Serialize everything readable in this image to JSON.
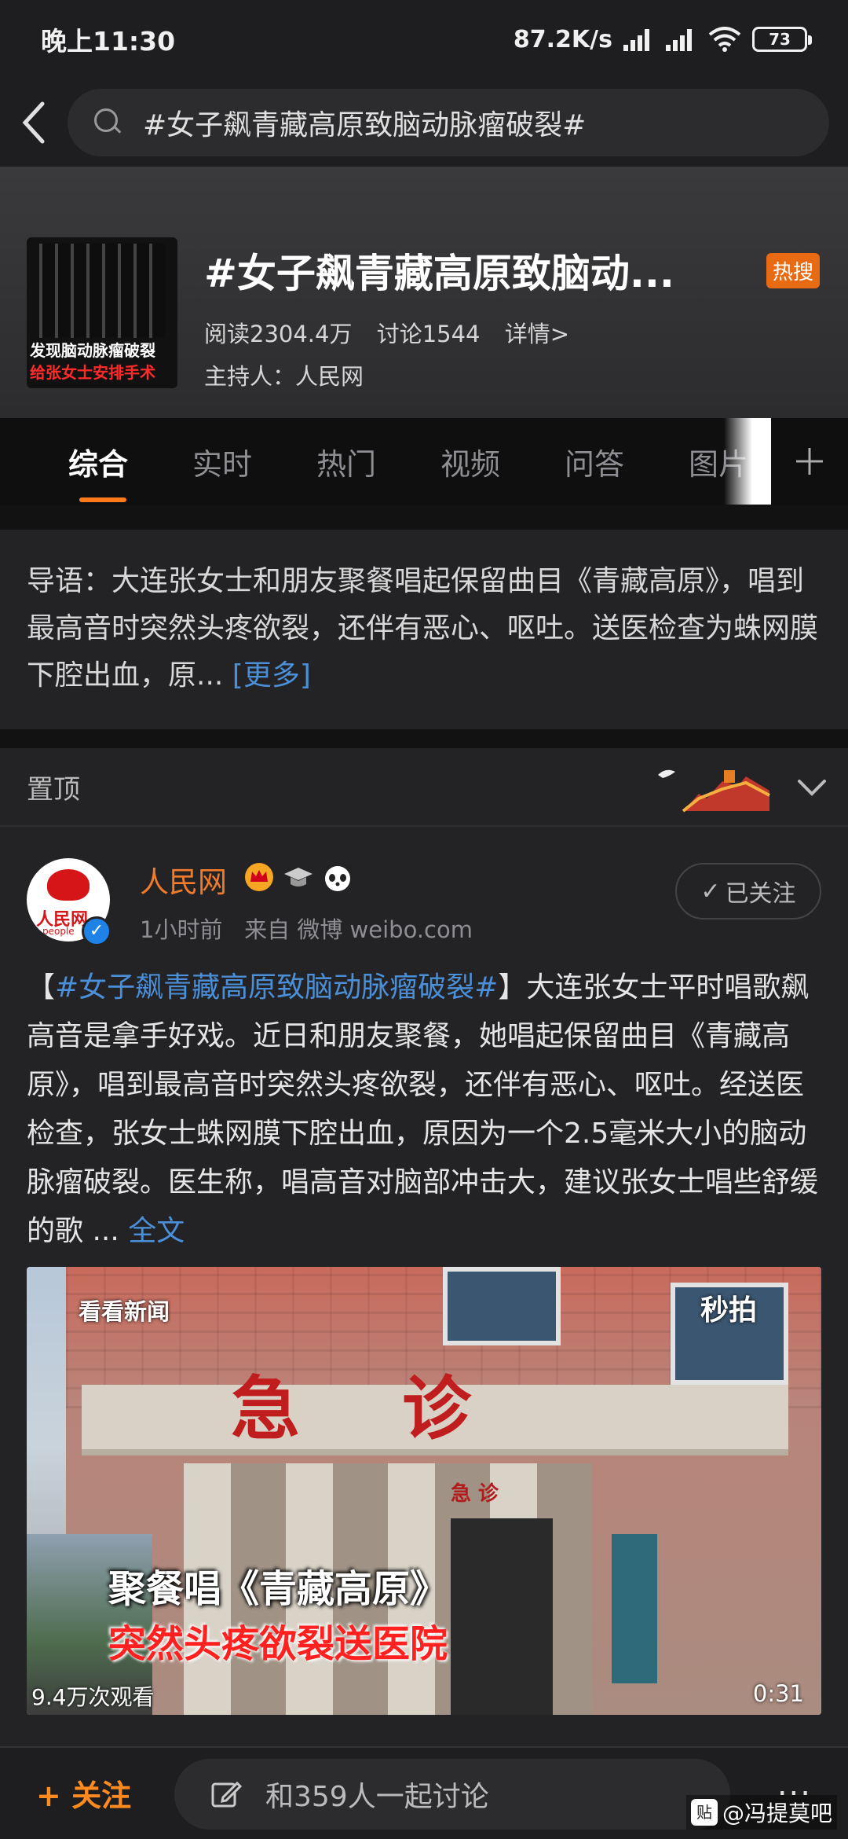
{
  "status_bar": {
    "time": "晚上11:30",
    "speed": "87.2K/s",
    "battery": "73"
  },
  "search": {
    "query": "#女子飙青藏高原致脑动脉瘤破裂#"
  },
  "topic": {
    "title": "#女子飙青藏高原致脑动...",
    "hot_badge": "热搜",
    "reads": "阅读2304.4万",
    "discussions": "讨论1544",
    "details_link": "详情>",
    "host": "主持人：人民网",
    "thumb_line1": "发现脑动脉瘤破裂",
    "thumb_line2": "给张女士安排手术"
  },
  "tabs": [
    "综合",
    "实时",
    "热门",
    "视频",
    "问答",
    "图片"
  ],
  "intro": {
    "text": "导语：大连张女士和朋友聚餐唱起保留曲目《青藏高原》，唱到最高音时突然头疼欲裂，还伴有恶心、呕吐。送医检查为蛛网膜下腔出血，原...",
    "more": "[更多]"
  },
  "pinned": {
    "label": "置顶"
  },
  "post": {
    "author": "人民网",
    "time": "1小时前",
    "source": "来自 微博 weibo.com",
    "follow_label": "已关注",
    "avatar_text": "人民网",
    "avatar_sub": "people",
    "bracket_open": "【",
    "tag": "#女子飙青藏高原致脑动脉瘤破裂#",
    "body": "】大连张女士平时唱歌飙高音是拿手好戏。近日和朋友聚餐，她唱起保留曲目《青藏高原》，唱到最高音时突然头疼欲裂，还伴有恶心、呕吐。经送医检查，张女士蛛网膜下腔出血，原因为一个2.5毫米大小的脑动脉瘤破裂。医生称，唱高音对脑部冲击大，建议张女士唱些舒缓的歌 ...",
    "fulltext": "全文"
  },
  "video": {
    "logo_left": "看看新闻",
    "logo_right": "秒拍",
    "sign": "急诊",
    "small_sign": "急 诊",
    "caption1": "聚餐唱《青藏高原》",
    "caption2": "突然头疼欲裂送医院",
    "views": "9.4万次观看",
    "duration": "0:31"
  },
  "bottom_bar": {
    "follow": "+ 关注",
    "discuss": "和359人一起讨论",
    "more": "...",
    "watermark": "@冯提莫吧",
    "watermark_icon": "贴"
  },
  "colors": {
    "accent": "#ff7a1a",
    "link": "#4a8fd8",
    "author": "#f07b2b",
    "hot": "#e86a12"
  }
}
